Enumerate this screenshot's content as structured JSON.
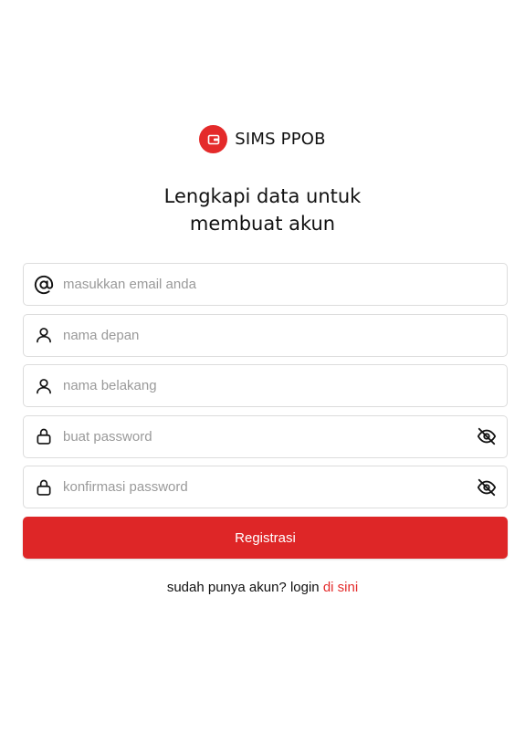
{
  "brand": {
    "name": "SIMS PPOB",
    "logo_color": "#e42a2a"
  },
  "title": {
    "line1": "Lengkapi data untuk",
    "line2": "membuat akun"
  },
  "fields": {
    "email": {
      "placeholder": "masukkan email anda",
      "value": "",
      "icon": "at-icon"
    },
    "first_name": {
      "placeholder": "nama depan",
      "value": "",
      "icon": "user-icon"
    },
    "last_name": {
      "placeholder": "nama belakang",
      "value": "",
      "icon": "user-icon"
    },
    "password": {
      "placeholder": "buat password",
      "value": "",
      "icon": "lock-icon",
      "toggle_icon": "eye-off-icon"
    },
    "confirm_password": {
      "placeholder": "konfirmasi password",
      "value": "",
      "icon": "lock-icon",
      "toggle_icon": "eye-off-icon"
    }
  },
  "submit": {
    "label": "Registrasi",
    "color": "#de2627"
  },
  "footer": {
    "prefix": "sudah punya akun? login ",
    "link_label": "di sini",
    "link_color": "#e42a2a"
  }
}
